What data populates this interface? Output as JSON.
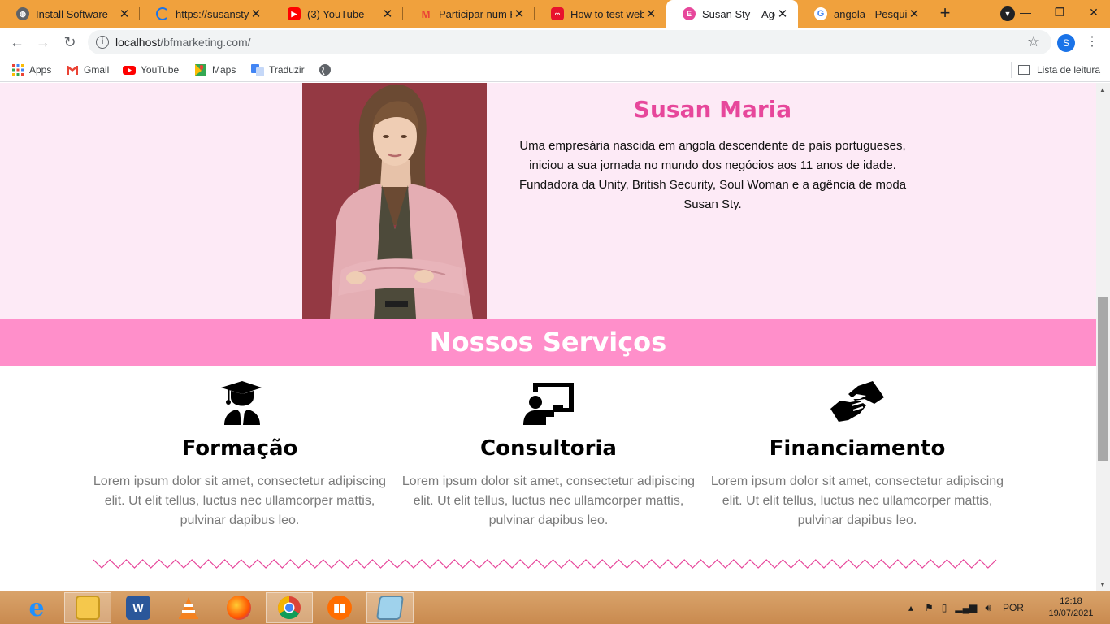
{
  "browser": {
    "tabs": [
      {
        "title": "Install Software",
        "icon": "globe-icon",
        "color": "#5f6368",
        "active": false
      },
      {
        "title": "https://susanstylist",
        "icon": "loading-icon",
        "color": "#1a73e8",
        "active": false
      },
      {
        "title": "(3) YouTube",
        "icon": "youtube-icon",
        "color": "#ff0000",
        "active": false
      },
      {
        "title": "Participar num Ha",
        "icon": "gmail-icon",
        "color": "#ea4335",
        "active": false
      },
      {
        "title": "How to test websit",
        "icon": "infinity-icon",
        "color": "#e8112d",
        "active": false
      },
      {
        "title": "Susan Sty – Agênc",
        "icon": "elementor-icon",
        "color": "#e7479b",
        "active": true
      },
      {
        "title": "angola - Pesquisa",
        "icon": "google-icon",
        "color": "#4285f4",
        "active": false
      }
    ],
    "new_tab_symbol": "+",
    "url_host": "localhost",
    "url_path": "/bfmarketing.com/",
    "profile_initial": "S",
    "bookmarks": [
      {
        "label": "Apps",
        "icon": "apps-grid-icon"
      },
      {
        "label": "Gmail",
        "icon": "gmail-icon"
      },
      {
        "label": "YouTube",
        "icon": "youtube-icon"
      },
      {
        "label": "Maps",
        "icon": "maps-icon"
      },
      {
        "label": "Traduzir",
        "icon": "translate-icon"
      },
      {
        "label": "",
        "icon": "globe-icon"
      }
    ],
    "reading_list": "Lista de leitura"
  },
  "page": {
    "profile": {
      "name": "Susan Maria",
      "bio": "Uma empresária nascida em angola descendente de país portugueses, iniciou a sua jornada no mundo dos negócios aos 11 anos de idade. Fundadora da Unity, British Security, Soul Woman e a agência de moda Susan Sty."
    },
    "services_title": "Nossos Serviços",
    "services": [
      {
        "title": "Formação",
        "icon": "graduate-icon",
        "text": "Lorem ipsum dolor sit amet, consectetur adipiscing elit. Ut elit tellus, luctus nec ullamcorper mattis, pulvinar dapibus leo."
      },
      {
        "title": "Consultoria",
        "icon": "presentation-icon",
        "text": "Lorem ipsum dolor sit amet, consectetur adipiscing elit. Ut elit tellus, luctus nec ullamcorper mattis, pulvinar dapibus leo."
      },
      {
        "title": "Financiamento",
        "icon": "handshake-icon",
        "text": "Lorem ipsum dolor sit amet, consectetur adipiscing elit. Ut elit tellus, luctus nec ullamcorper mattis, pulvinar dapibus leo."
      }
    ],
    "accent_color": "#e7479b",
    "band_color": "#ff8fca",
    "hero_bg": "#fdeaf6"
  },
  "taskbar": {
    "apps": [
      "internet-explorer",
      "file-explorer",
      "word",
      "vlc",
      "firefox",
      "chrome",
      "charts-app",
      "notepad"
    ],
    "language": "POR",
    "time": "12:18",
    "date": "19/07/2021"
  }
}
